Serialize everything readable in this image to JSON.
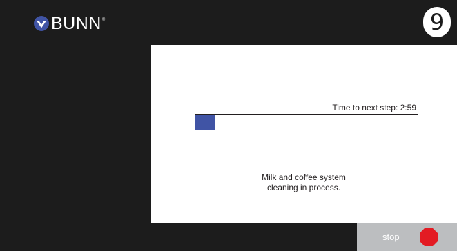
{
  "brand": {
    "name": "BUNN",
    "trademark": "®",
    "logo_color": "#4054a5"
  },
  "step": {
    "number": "9"
  },
  "progress": {
    "label": "Time to next step: 2:59",
    "fraction": 0.09,
    "fill_color": "#4054a5"
  },
  "status": {
    "line1": "Milk and coffee system",
    "line2": "cleaning in process."
  },
  "controls": {
    "stop_label": "stop",
    "stop_icon": "stop-sign-icon",
    "stop_icon_color": "#e31b23"
  }
}
